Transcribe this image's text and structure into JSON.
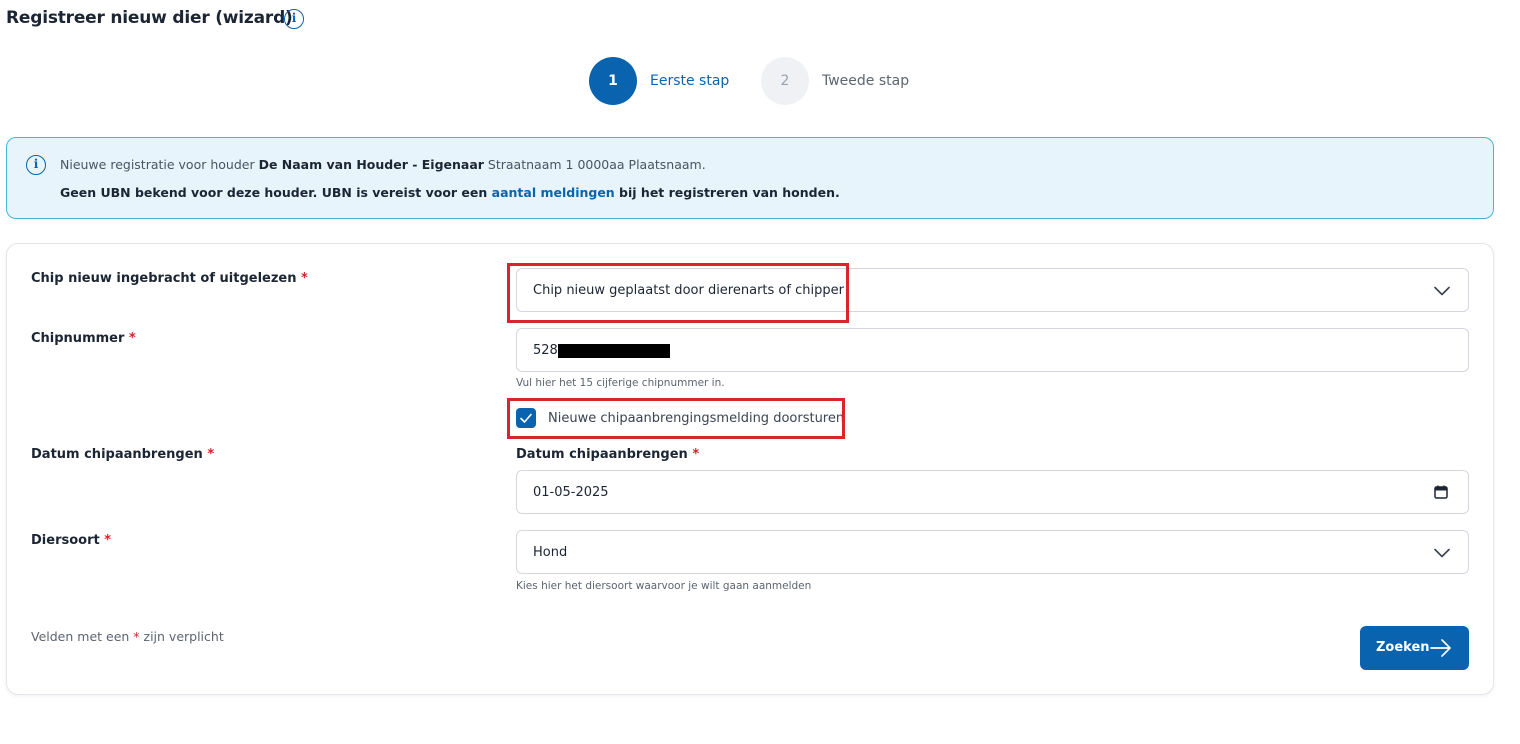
{
  "page": {
    "title": "Registreer nieuw dier (wizard)",
    "info_icon": "info-icon"
  },
  "stepper": {
    "steps": [
      {
        "number": "1",
        "label": "Eerste stap",
        "active": true
      },
      {
        "number": "2",
        "label": "Tweede stap",
        "active": false
      }
    ]
  },
  "info_banner": {
    "icon": "info-icon",
    "line1_prefix": "Nieuwe registratie voor houder ",
    "holder_name": "De Naam van Houder - Eigenaar",
    "holder_address": " Straatnaam 1 0000aa Plaatsnaam.",
    "line2_prefix": "Geen UBN bekend voor deze houder. UBN is vereist voor een ",
    "line2_link": "aantal meldingen",
    "line2_suffix": " bij het registreren van honden."
  },
  "form": {
    "chip_source": {
      "label": "Chip nieuw ingebracht of uitgelezen",
      "required_mark": "*",
      "value": "Chip nieuw geplaatst door dierenarts of chipper"
    },
    "chip_number": {
      "label": "Chipnummer",
      "required_mark": "*",
      "value": "528",
      "hint": "Vul hier het 15 cijferige chipnummer in."
    },
    "forward_notification": {
      "label": "Nieuwe chipaanbrengingsmelding doorsturen",
      "checked": true
    },
    "chip_date": {
      "label": "Datum chipaanbrengen",
      "inner_label": "Datum chipaanbrengen",
      "required_mark": "*",
      "value": "01-05-2025",
      "icon": "calendar-icon"
    },
    "species": {
      "label": "Diersoort",
      "required_mark": "*",
      "value": "Hond",
      "hint": "Kies hier het diersoort waarvoor je wilt gaan aanmelden"
    },
    "footer_note_prefix": "Velden met een ",
    "footer_note_mark": "*",
    "footer_note_suffix": " zijn verplicht",
    "submit_label": "Zoeken",
    "submit_icon": "arrow-right-icon"
  },
  "colors": {
    "primary": "#0a63ae",
    "required": "#d2232a",
    "highlight": "#d9262c",
    "info_bg": "#e7f4fb"
  }
}
